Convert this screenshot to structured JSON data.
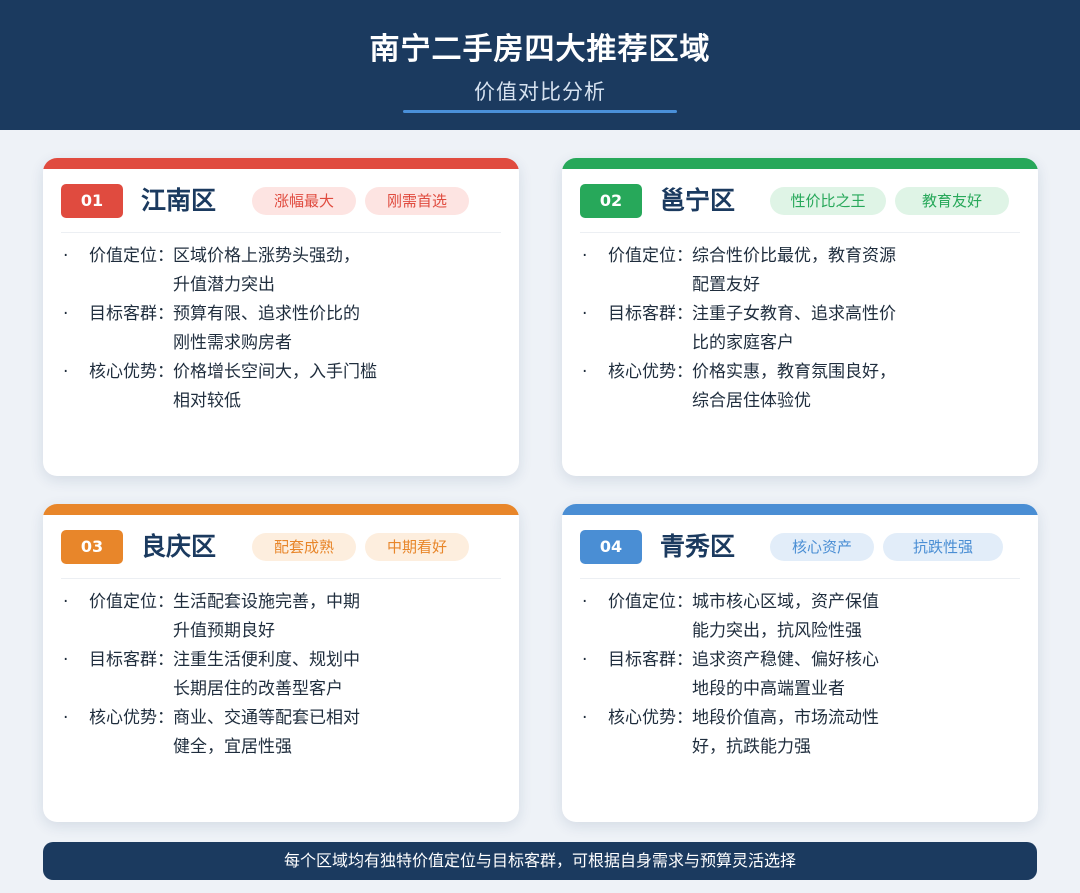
{
  "header": {
    "title": "南宁二手房四大推荐区域",
    "subtitle": "价值对比分析"
  },
  "cards": [
    {
      "number": "01",
      "name": "江南区",
      "color": "#e04b3f",
      "tags": [
        {
          "label": "涨幅最大",
          "bg": "#fde4e2",
          "fg": "#e04b3f"
        },
        {
          "label": "刚需首选",
          "bg": "#fde4e2",
          "fg": "#e04b3f"
        }
      ],
      "items": [
        {
          "label": "价值定位：",
          "text": "区域价格上涨势头强劲，\n升值潜力突出"
        },
        {
          "label": "目标客群：",
          "text": "预算有限、追求性价比的\n刚性需求购房者"
        },
        {
          "label": "核心优势：",
          "text": "价格增长空间大，入手门槛\n相对较低"
        }
      ]
    },
    {
      "number": "02",
      "name": "邕宁区",
      "color": "#27a85a",
      "tags": [
        {
          "label": "性价比之王",
          "bg": "#dff4e6",
          "fg": "#27a85a"
        },
        {
          "label": "教育友好",
          "bg": "#dff4e6",
          "fg": "#27a85a"
        }
      ],
      "items": [
        {
          "label": "价值定位：",
          "text": "综合性价比最优，教育资源\n配置友好"
        },
        {
          "label": "目标客群：",
          "text": "注重子女教育、追求高性价\n比的家庭客户"
        },
        {
          "label": "核心优势：",
          "text": "价格实惠，教育氛围良好，\n综合居住体验优"
        }
      ]
    },
    {
      "number": "03",
      "name": "良庆区",
      "color": "#e8862a",
      "tags": [
        {
          "label": "配套成熟",
          "bg": "#fdeede",
          "fg": "#e8862a"
        },
        {
          "label": "中期看好",
          "bg": "#fdeede",
          "fg": "#e8862a"
        }
      ],
      "items": [
        {
          "label": "价值定位：",
          "text": "生活配套设施完善，中期\n升值预期良好"
        },
        {
          "label": "目标客群：",
          "text": "注重生活便利度、规划中\n长期居住的改善型客户"
        },
        {
          "label": "核心优势：",
          "text": "商业、交通等配套已相对\n健全，宜居性强"
        }
      ]
    },
    {
      "number": "04",
      "name": "青秀区",
      "color": "#4a8ed4",
      "tags": [
        {
          "label": "核心资产",
          "bg": "#e2edf9",
          "fg": "#4a8ed4"
        },
        {
          "label": "抗跌性强",
          "bg": "#e2edf9",
          "fg": "#4a8ed4"
        }
      ],
      "items": [
        {
          "label": "价值定位：",
          "text": "城市核心区域，资产保值\n能力突出，抗风险性强"
        },
        {
          "label": "目标客群：",
          "text": "追求资产稳健、偏好核心\n地段的中高端置业者"
        },
        {
          "label": "核心优势：",
          "text": "地段价值高，市场流动性\n好，抗跌能力强"
        }
      ]
    }
  ],
  "bullet": "·",
  "footer": "每个区域均有独特价值定位与目标客群，可根据自身需求与预算灵活选择"
}
